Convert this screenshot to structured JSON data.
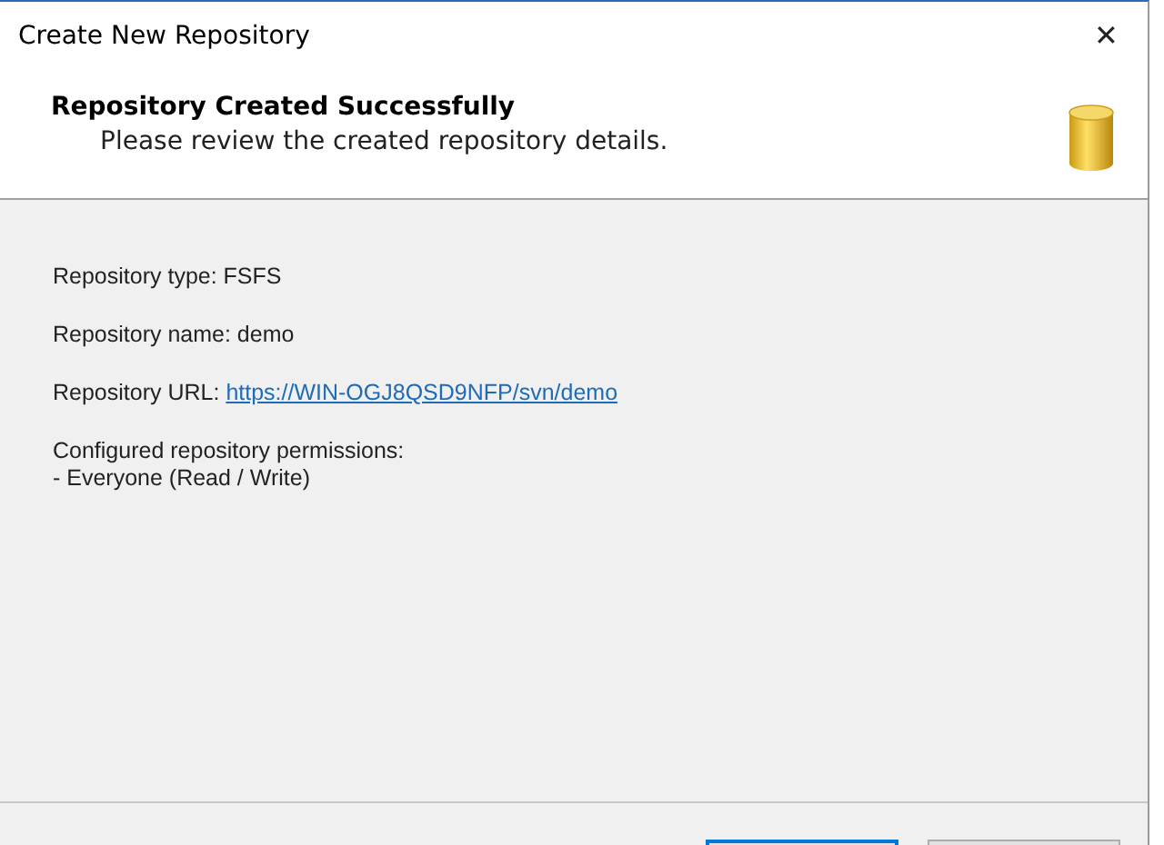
{
  "window": {
    "title": "Create New Repository",
    "close": "✕"
  },
  "header": {
    "title": "Repository Created Successfully",
    "subtitle": "Please review the created repository details."
  },
  "details": [
    {
      "kind": "text",
      "text": "Repository type: FSFS"
    },
    {
      "kind": "text",
      "text": "Repository name: demo"
    },
    {
      "kind": "link",
      "label": "Repository URL: ",
      "link": "https://WIN-OGJ8QSD9NFP/svn/demo"
    },
    {
      "kind": "lines",
      "lines": [
        "Configured repository permissions:",
        "- Everyone (Read / Write)"
      ]
    }
  ],
  "buttons": [
    {
      "focused": true
    },
    {
      "focused": false
    }
  ]
}
